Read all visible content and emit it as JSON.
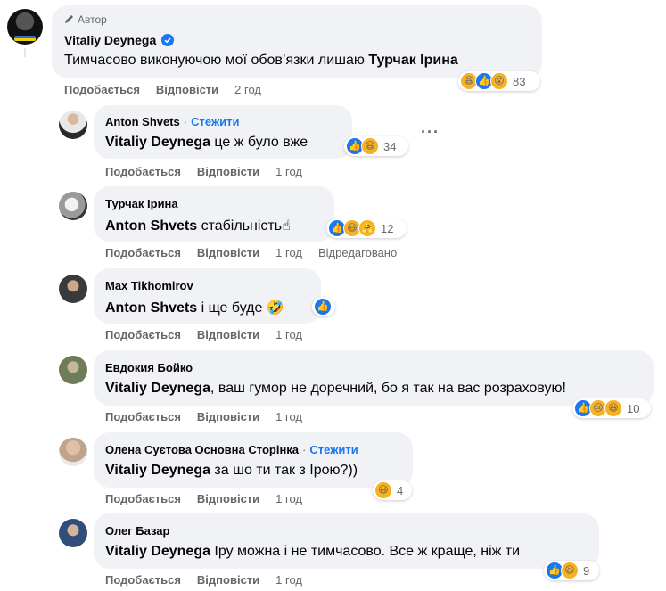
{
  "main_comment": {
    "author_badge": "Автор",
    "author": "Vitaliy Deynega",
    "text": "Тимчасово виконуючою мої обов’язки лишаю ",
    "mention": "Турчак Ірина",
    "like_label": "Подобається",
    "reply_label": "Відповісти",
    "time": "2 год",
    "reactions_count": "83"
  },
  "replies": [
    {
      "author": "Anton Shvets",
      "follow": "Стежити",
      "mention": "Vitaliy Deynega",
      "text": " це ж було вже",
      "like_label": "Подобається",
      "reply_label": "Відповісти",
      "time": "1 год",
      "reactions_count": "34"
    },
    {
      "author": "Турчак Ірина",
      "mention": "Anton Shvets",
      "text": " стабільність☝",
      "like_label": "Подобається",
      "reply_label": "Відповісти",
      "time": "1 год",
      "edited": "Відредаговано",
      "reactions_count": "12"
    },
    {
      "author": "Max Tikhomirov",
      "mention": "Anton Shvets",
      "text": " і ще буде 🤣",
      "like_label": "Подобається",
      "reply_label": "Відповісти",
      "time": "1 год"
    },
    {
      "author": "Евдокия Бойко",
      "mention": "Vitaliy Deynega",
      "text": ", ваш гумор не доречний, бо я так на вас розраховую!",
      "like_label": "Подобається",
      "reply_label": "Відповісти",
      "time": "1 год",
      "reactions_count": "10"
    },
    {
      "author": "Олена Суєтова Основна Сторінка",
      "follow": "Стежити",
      "mention": "Vitaliy Deynega",
      "text": " за шо ти так з Ірою?))",
      "like_label": "Подобається",
      "reply_label": "Відповісти",
      "time": "1 год",
      "reactions_count": "4"
    },
    {
      "author": "Олег Базар",
      "mention": "Vitaliy Deynega",
      "text": " Іру можна і не тимчасово. Все ж краще, ніж ти",
      "like_label": "Подобається",
      "reply_label": "Відповісти",
      "time": "1 год",
      "reactions_count": "9"
    }
  ],
  "icons": {
    "author_badge": "pencil-icon",
    "verified": "verified-badge-icon",
    "more": "more-options-icon",
    "like": "like-reaction-icon",
    "haha": "haha-reaction-icon",
    "wow": "wow-reaction-icon",
    "sad": "sad-reaction-icon",
    "care": "care-reaction-icon"
  },
  "colors": {
    "bubble": "#f0f2f5",
    "link": "#1877f2",
    "secondary_text": "#65676b"
  }
}
